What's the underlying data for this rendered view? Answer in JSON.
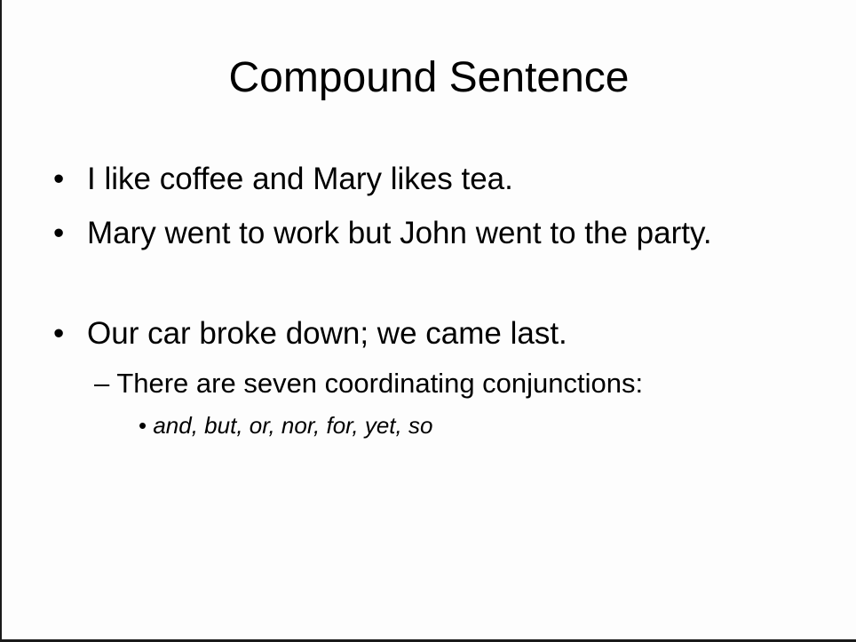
{
  "slide": {
    "title": "Compound Sentence",
    "bullets": [
      {
        "marker": "•",
        "text": "I like coffee and Mary likes tea."
      },
      {
        "marker": "•",
        "text": "Mary went to work but John went to the party."
      },
      {
        "marker": "•",
        "text": "Our car broke down; we came last."
      }
    ],
    "sub_bullet": {
      "marker": "–",
      "text": "There are seven coordinating conjunctions:"
    },
    "sub_sub_bullet": {
      "marker": "•",
      "text": "and, but, or, nor, for, yet, so"
    }
  }
}
